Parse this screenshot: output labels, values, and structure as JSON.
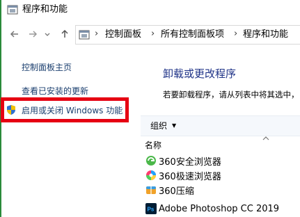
{
  "window": {
    "title": "程序和功能"
  },
  "nav": {
    "back_icon": "arrow-left",
    "forward_icon": "arrow-right",
    "recent_icon": "chevron-down",
    "up_icon": "arrow-up"
  },
  "address": {
    "crumbs": [
      "控制面板",
      "所有控制面板项",
      "程序和功能"
    ],
    "separator": "›"
  },
  "left_pane": {
    "home_link": "控制面板主页",
    "installed_updates_link": "查看已安装的更新",
    "windows_features_link": "启用或关闭 Windows 功能"
  },
  "main": {
    "title": "卸载或更改程序",
    "description": "若要卸载程序，请从列表中将其选中，",
    "organize_label": "组织",
    "column_name": "名称"
  },
  "programs": [
    {
      "name": "360安全浏览器",
      "icon": "360-secure-browser-icon"
    },
    {
      "name": "360极速浏览器",
      "icon": "360-speed-browser-icon"
    },
    {
      "name": "360压缩",
      "icon": "360-zip-icon"
    },
    {
      "name": "Adobe Photoshop CC 2019",
      "icon": "photoshop-icon"
    }
  ],
  "colors": {
    "highlight_border": "#e60012",
    "link": "#1a3e6e",
    "main_title": "#1e3287"
  }
}
